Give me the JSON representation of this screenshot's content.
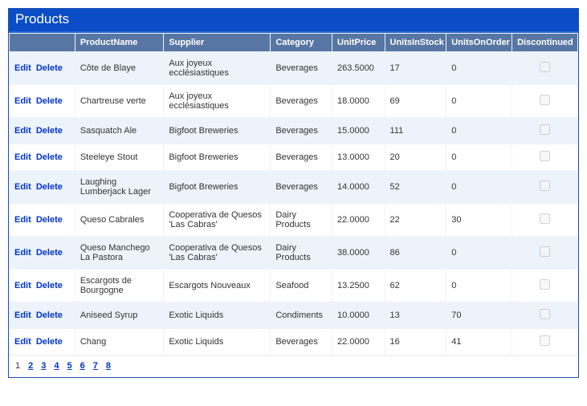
{
  "title": "Products",
  "actions": {
    "edit": "Edit",
    "delete": "Delete"
  },
  "headers": {
    "product": "ProductName",
    "supplier": "Supplier",
    "category": "Category",
    "price": "UnitPrice",
    "stock": "UnitsInStock",
    "order": "UnitsOnOrder",
    "discontinued": "Discontinued"
  },
  "rows": [
    {
      "product": "Côte de Blaye",
      "supplier": "Aux joyeux ecclésiastiques",
      "category": "Beverages",
      "price": "263.5000",
      "stock": "17",
      "order": "0",
      "discontinued": false
    },
    {
      "product": "Chartreuse verte",
      "supplier": "Aux joyeux ecclésiastiques",
      "category": "Beverages",
      "price": "18.0000",
      "stock": "69",
      "order": "0",
      "discontinued": false
    },
    {
      "product": "Sasquatch Ale",
      "supplier": "Bigfoot Breweries",
      "category": "Beverages",
      "price": "15.0000",
      "stock": "111",
      "order": "0",
      "discontinued": false
    },
    {
      "product": "Steeleye Stout",
      "supplier": "Bigfoot Breweries",
      "category": "Beverages",
      "price": "13.0000",
      "stock": "20",
      "order": "0",
      "discontinued": false
    },
    {
      "product": "Laughing Lumberjack Lager",
      "supplier": "Bigfoot Breweries",
      "category": "Beverages",
      "price": "14.0000",
      "stock": "52",
      "order": "0",
      "discontinued": false
    },
    {
      "product": "Queso Cabrales",
      "supplier": "Cooperativa de Quesos 'Las Cabras'",
      "category": "Dairy Products",
      "price": "22.0000",
      "stock": "22",
      "order": "30",
      "discontinued": false
    },
    {
      "product": "Queso Manchego La Pastora",
      "supplier": "Cooperativa de Quesos 'Las Cabras'",
      "category": "Dairy Products",
      "price": "38.0000",
      "stock": "86",
      "order": "0",
      "discontinued": false
    },
    {
      "product": "Escargots de Bourgogne",
      "supplier": "Escargots Nouveaux",
      "category": "Seafood",
      "price": "13.2500",
      "stock": "62",
      "order": "0",
      "discontinued": false
    },
    {
      "product": "Aniseed Syrup",
      "supplier": "Exotic Liquids",
      "category": "Condiments",
      "price": "10.0000",
      "stock": "13",
      "order": "70",
      "discontinued": false
    },
    {
      "product": "Chang",
      "supplier": "Exotic Liquids",
      "category": "Beverages",
      "price": "22.0000",
      "stock": "16",
      "order": "41",
      "discontinued": false
    }
  ],
  "pager": {
    "current": 1,
    "pages": [
      1,
      2,
      3,
      4,
      5,
      6,
      7,
      8
    ]
  }
}
